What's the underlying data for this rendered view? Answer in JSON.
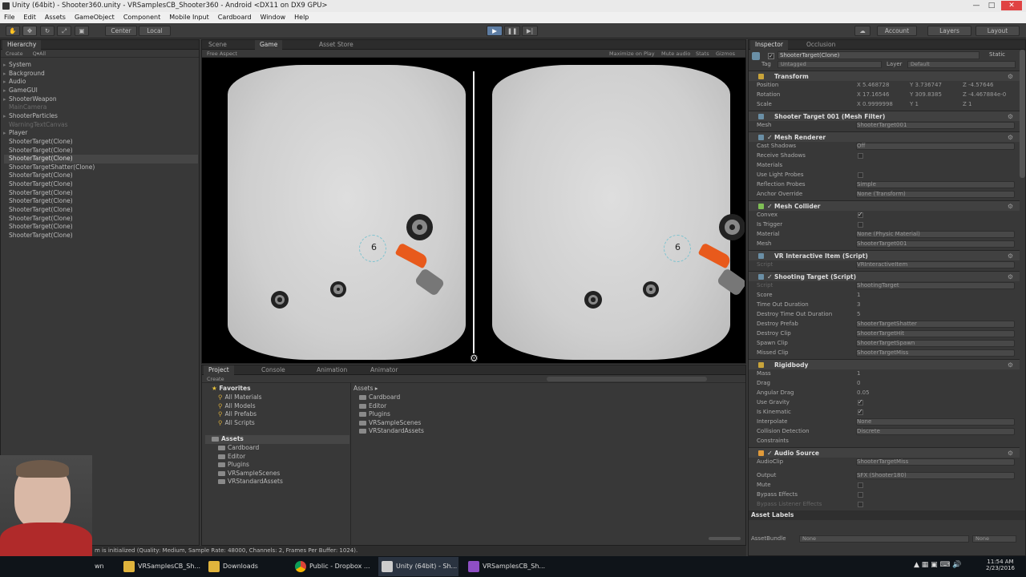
{
  "window": {
    "title": "Unity (64bit) - Shooter360.unity - VRSamplesCB_Shooter360 - Android <DX11 on DX9 GPU>"
  },
  "menu": [
    "File",
    "Edit",
    "Assets",
    "GameObject",
    "Component",
    "Mobile Input",
    "Cardboard",
    "Window",
    "Help"
  ],
  "toolbar": {
    "center": "Center",
    "local": "Local",
    "account": "Account",
    "layers": "Layers",
    "layout": "Layout"
  },
  "hierarchy": {
    "tab": "Hierarchy",
    "create": "Create",
    "search": "Q▾All",
    "items": [
      "System",
      "Background",
      "Audio",
      "GameGUI",
      "ShooterWeapon",
      "MainCamera",
      "ShooterParticles",
      "WarningTextCanvas",
      "Player",
      "ShooterTarget(Clone)",
      "ShooterTarget(Clone)",
      "ShooterTarget(Clone)",
      "ShooterTargetShatter(Clone)",
      "ShooterTarget(Clone)",
      "ShooterTarget(Clone)",
      "ShooterTarget(Clone)",
      "ShooterTarget(Clone)",
      "ShooterTarget(Clone)",
      "ShooterTarget(Clone)",
      "ShooterTarget(Clone)",
      "ShooterTarget(Clone)"
    ]
  },
  "center": {
    "tabs": [
      "Scene",
      "Game",
      "Asset Store"
    ],
    "aspect": "Free Aspect",
    "maximize": "Maximize on Play",
    "mute": "Mute audio",
    "stats": "Stats",
    "gizmos": "Gizmos",
    "score_left": "6",
    "score_right": "6"
  },
  "project": {
    "tabs": [
      "Project",
      "Console",
      "Animation",
      "Animator"
    ],
    "create": "Create",
    "favorites_title": "Favorites",
    "favorites": [
      "All Materials",
      "All Models",
      "All Prefabs",
      "All Scripts"
    ],
    "assets_title": "Assets",
    "assets": [
      "Cardboard",
      "Editor",
      "Plugins",
      "VRSampleScenes",
      "VRStandardAssets"
    ],
    "breadcrumb": "Assets ▸",
    "folder_items": [
      "Cardboard",
      "Editor",
      "Plugins",
      "VRSampleScenes",
      "VRStandardAssets"
    ]
  },
  "status": "m is initialized (Quality: Medium, Sample Rate: 48000, Channels: 2, Frames Per Buffer: 1024).",
  "inspector": {
    "tabs": [
      "Inspector",
      "Occlusion"
    ],
    "object_name": "ShooterTarget(Clone)",
    "static": "Static",
    "tag_label": "Tag",
    "tag": "Untagged",
    "layer_label": "Layer",
    "layer": "Default",
    "transform_title": "Transform",
    "position_label": "Position",
    "pos": [
      "X 5.468728",
      "Y 3.736747",
      "Z -4.57646"
    ],
    "rotation_label": "Rotation",
    "rot": [
      "X 17.16546",
      "Y 309.8385",
      "Z -4.467884e-0"
    ],
    "scale_label": "Scale",
    "scl": [
      "X 0.9999998",
      "Y 1",
      "Z 1"
    ],
    "meshfilter_title": "Shooter Target 001 (Mesh Filter)",
    "mesh_label": "Mesh",
    "mesh": "ShooterTarget001",
    "renderer_title": "Mesh Renderer",
    "cast_label": "Cast Shadows",
    "cast": "Off",
    "receive_label": "Receive Shadows",
    "materials_label": "Materials",
    "lightprobes_label": "Use Light Probes",
    "reflection_label": "Reflection Probes",
    "reflection": "Simple",
    "anchor_label": "Anchor Override",
    "anchor": "None (Transform)",
    "collider_title": "Mesh Collider",
    "convex_label": "Convex",
    "trigger_label": "Is Trigger",
    "material_label": "Material",
    "material": "None (Physic Material)",
    "mesh2_label": "Mesh",
    "mesh2": "ShooterTarget001",
    "vrint_title": "VR Interactive Item (Script)",
    "script_label": "Script",
    "vrint_script": "VRInteractiveItem",
    "shoot_title": "Shooting Target (Script)",
    "shoot_script": "ShootingTarget",
    "score_label": "Score",
    "score": "1",
    "timeout_label": "Time Out Duration",
    "timeout": "3",
    "destroytime_label": "Destroy Time Out Duration",
    "destroytime": "5",
    "destroyprefab_label": "Destroy Prefab",
    "destroyprefab": "ShooterTargetShatter",
    "destroyclip_label": "Destroy Clip",
    "destroyclip": "ShooterTargetHit",
    "spawnclip_label": "Spawn Clip",
    "spawnclip": "ShooterTargetSpawn",
    "missedclip_label": "Missed Clip",
    "missedclip": "ShooterTargetMiss",
    "rb_title": "Rigidbody",
    "mass_label": "Mass",
    "mass": "1",
    "drag_label": "Drag",
    "drag": "0",
    "angdrag_label": "Angular Drag",
    "angdrag": "0.05",
    "gravity_label": "Use Gravity",
    "kinematic_label": "Is Kinematic",
    "interp_label": "Interpolate",
    "interp": "None",
    "collision_label": "Collision Detection",
    "collision": "Discrete",
    "constraints_label": "Constraints",
    "audio_title": "Audio Source",
    "audioclip_label": "AudioClip",
    "audioclip": "ShooterTargetMiss",
    "output_label": "Output",
    "output": "SFX (Shooter180)",
    "mute_label": "Mute",
    "bypass_label": "Bypass Effects",
    "bypasslistener_label": "Bypass Listener Effects",
    "assetlabels": "Asset Labels",
    "assetbundle_label": "AssetBundle",
    "assetbundle": "None",
    "assetbundle2": "None"
  },
  "taskbar": {
    "items": [
      "wn",
      "VRSamplesCB_Sh...",
      "Downloads",
      "Public - Dropbox ...",
      "Unity (64bit) - Sh...",
      "VRSamplesCB_Sh..."
    ],
    "time": "11:54 AM",
    "date": "2/23/2016"
  }
}
